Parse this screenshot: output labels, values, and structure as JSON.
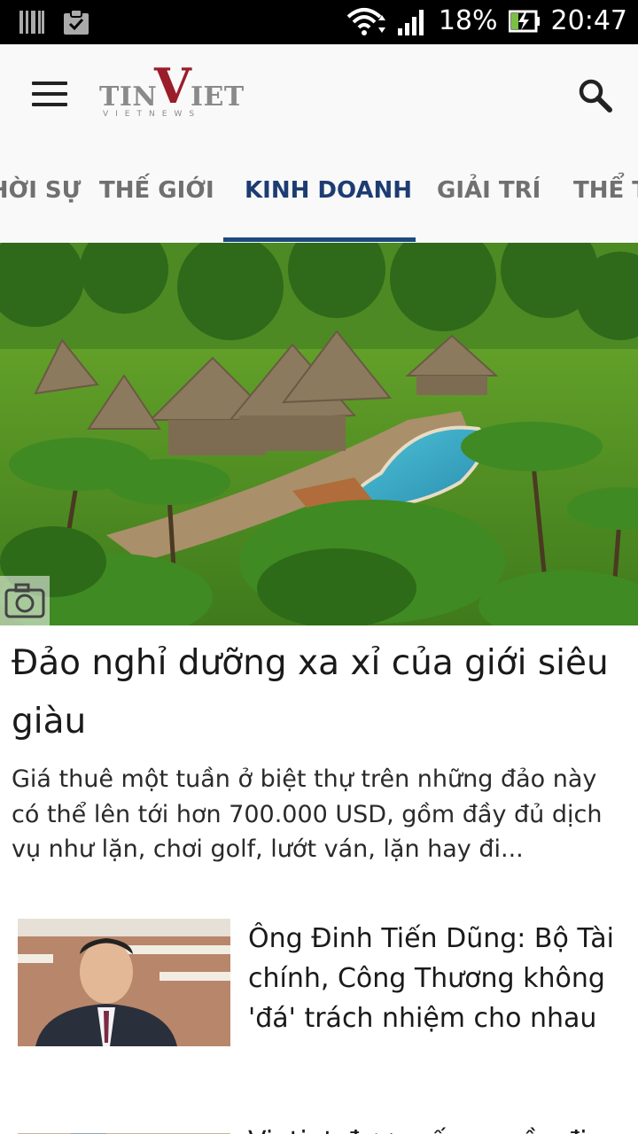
{
  "status_bar": {
    "battery_percent": "18%",
    "time": "20:47",
    "icons": [
      "barcode-icon",
      "clipboard-check-icon",
      "wifi-icon",
      "signal-icon",
      "battery-charging-icon"
    ]
  },
  "header": {
    "logo_text_left": "TIN",
    "logo_text_v": "V",
    "logo_text_right": "IET",
    "logo_subtext": "VIETNEWS"
  },
  "tabs": [
    {
      "label": "THỜI SỰ"
    },
    {
      "label": "THẾ GIỚI"
    },
    {
      "label": "KINH DOANH",
      "active": true
    },
    {
      "label": "GIẢI TRÍ"
    },
    {
      "label": "THỂ THAO"
    }
  ],
  "featured": {
    "headline": "Đảo nghỉ dưỡng xa xỉ của giới siêu giàu",
    "summary": "Giá thuê một tuần ở biệt thự trên những đảo này có thể lên tới hơn 700.000 USD, gồm đầy đủ dịch vụ như lặn, chơi golf, lướt ván, lặn hay đi..."
  },
  "articles": [
    {
      "title": "Ông Đinh Tiến Dũng: Bộ Tài chính, Công Thương không 'đá' trách nhiệm cho nhau"
    },
    {
      "title": "Vietjet được cấp quyền đi"
    }
  ],
  "colors": {
    "accent": "#1d4a7d",
    "logo_red": "#9b1d2a",
    "tab_inactive": "#707070"
  }
}
